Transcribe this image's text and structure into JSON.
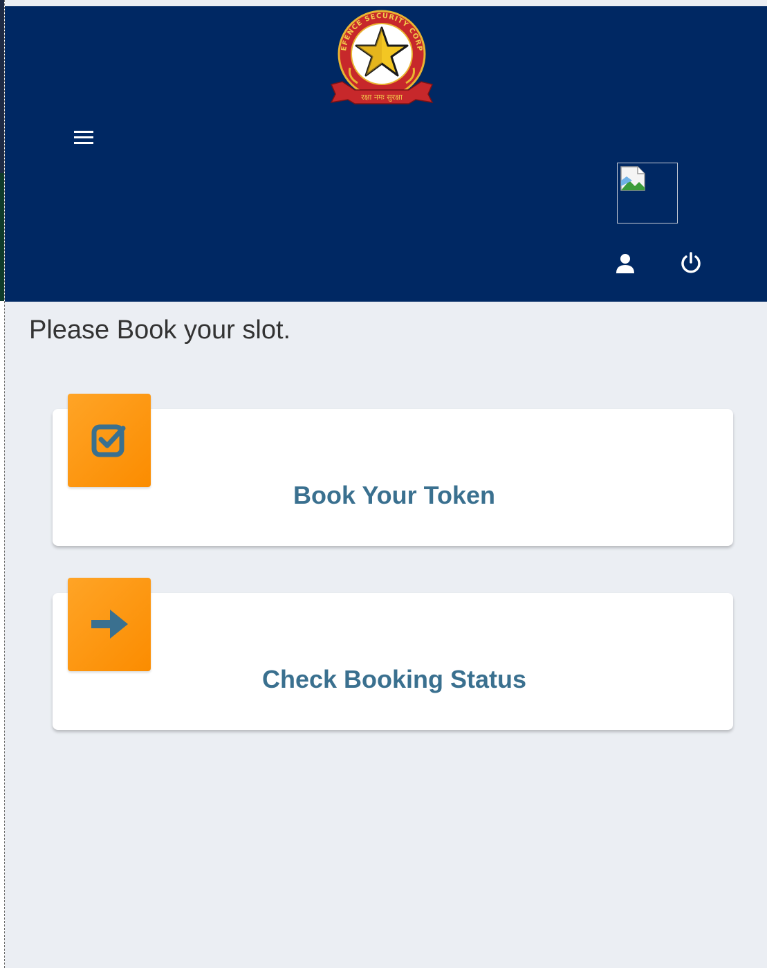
{
  "header": {
    "logo": {
      "ring_text": "DEFENCE SECURITY CORPS",
      "motto": "रक्षा नमः सुरक्षा"
    },
    "menu_icon": "hamburger-icon",
    "user_icon": "user-icon",
    "power_icon": "power-icon",
    "background_color": "#002863"
  },
  "main": {
    "prompt": "Please Book your slot.",
    "cards": [
      {
        "label": "Book Your Token",
        "icon": "check-square-icon"
      },
      {
        "label": "Check Booking Status",
        "icon": "arrow-right-icon"
      }
    ],
    "tile_color": "#fb8c00",
    "label_color": "#3a708f"
  }
}
